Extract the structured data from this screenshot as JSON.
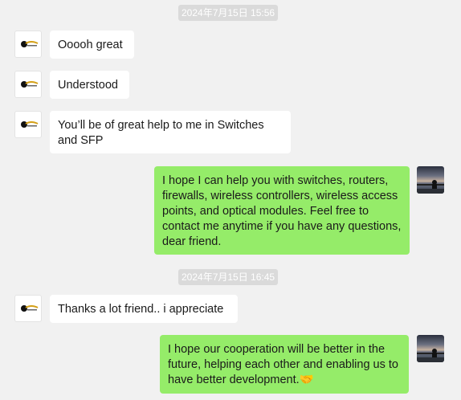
{
  "conversation": {
    "timestamps": [
      "2024年7月15日 15:56",
      "2024年7月15日 16:45"
    ],
    "messages": [
      {
        "sender": "contact",
        "text": "Ooooh great"
      },
      {
        "sender": "contact",
        "text": "Understood"
      },
      {
        "sender": "contact",
        "text": "You’ll be of great help to me in Switches and SFP"
      },
      {
        "sender": "me",
        "text": "I hope I can help you with switches, routers, firewalls, wireless controllers, wireless access points, and optical modules. Feel free to contact me anytime if you have any questions, dear friend."
      },
      {
        "sender": "contact",
        "text": "Thanks a lot friend.. i appreciate"
      },
      {
        "sender": "me",
        "text": "I hope our cooperation will be better in the future, helping each other and enabling us to have better development.🤝"
      }
    ]
  },
  "colors": {
    "background": "#f1f1f1",
    "incoming_bubble": "#ffffff",
    "outgoing_bubble": "#95ec69",
    "timestamp_bg": "#dadada",
    "logo_accent": "#d4a017"
  },
  "icons": {
    "contact_avatar": "company-logo-icon",
    "my_avatar": "user-photo-avatar"
  }
}
